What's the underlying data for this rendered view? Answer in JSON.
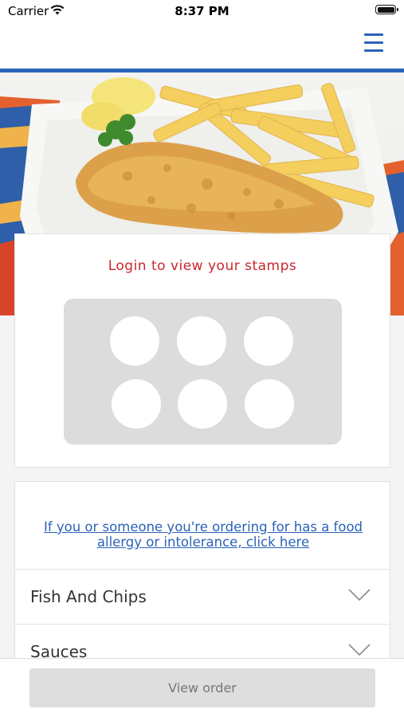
{
  "status_bar": {
    "carrier": "Carrier",
    "time": "8:37 PM"
  },
  "nav": {
    "menu_icon": "hamburger-menu-icon",
    "accent_color": "#2a63b8"
  },
  "hero": {
    "image": "fish-and-chips-photo"
  },
  "stamps": {
    "title": "Login to view your stamps",
    "title_color": "#c9272e",
    "total": 6,
    "collected": 0
  },
  "allergy_notice": {
    "text": "If you or someone you're ordering for has a food allergy or intolerance, click here"
  },
  "menu_categories": [
    {
      "label": "Fish And Chips",
      "icon": "chevron-down-icon"
    },
    {
      "label": "Sauces",
      "icon": "chevron-down-icon"
    }
  ],
  "footer": {
    "view_order_label": "View order"
  }
}
